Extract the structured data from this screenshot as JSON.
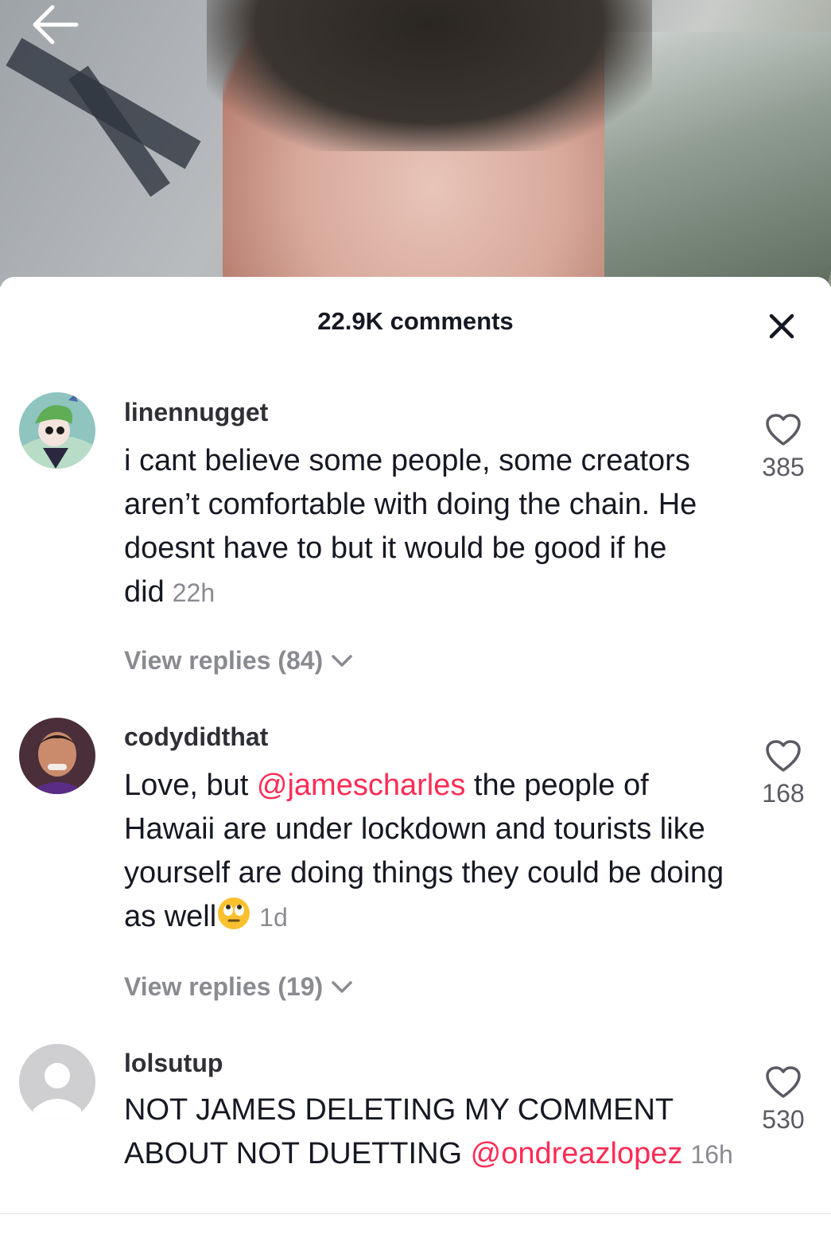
{
  "header": {
    "comment_count": "22.9K comments"
  },
  "comments": [
    {
      "username": "linennugget",
      "text": "i cant believe some people, some creators aren’t comfortable with doing the chain. He doesnt have to but it would be good if he did",
      "time": "22h",
      "likes": "385",
      "replies": "View replies (84)"
    },
    {
      "username": "codydidthat",
      "text_before": "Love, but ",
      "mention": "@jamescharles",
      "text_after": " the people of Hawaii are under lockdown and tourists like yourself are doing things they could be doing as well",
      "time": "1d",
      "likes": "168",
      "replies": "View replies (19)"
    },
    {
      "username": "lolsutup",
      "text_before": "NOT JAMES DELETING MY COMMENT ABOUT NOT DUETTING ",
      "mention": "@ondreazlopez",
      "time": "16h",
      "likes": "530"
    }
  ],
  "colors": {
    "mention": "#fe2c55",
    "text": "#161823",
    "muted": "#8a8b91"
  },
  "icons": [
    "back-arrow-icon",
    "close-icon",
    "heart-outline-icon",
    "chevron-down-icon",
    "eye-roll-emoji-icon",
    "default-avatar-icon"
  ]
}
